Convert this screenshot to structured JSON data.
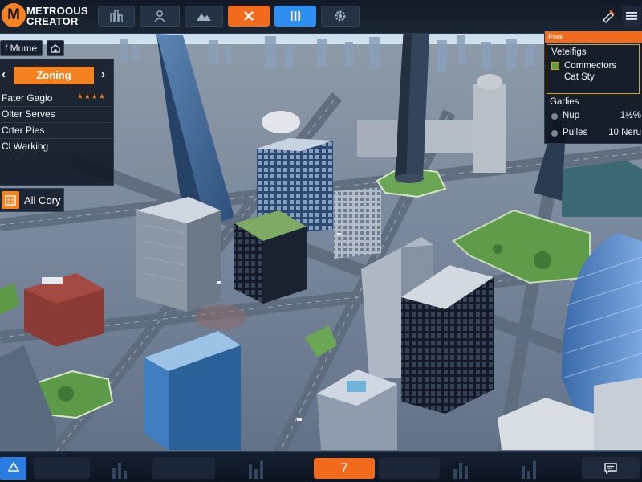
{
  "app": {
    "logo_letter": "M",
    "logo_line1": "METROOUS",
    "logo_line2": "CREATOR"
  },
  "toolbar": {
    "buttons": [
      {
        "icon": "city-buildings-icon",
        "state": "normal"
      },
      {
        "icon": "worker-icon",
        "state": "normal"
      },
      {
        "icon": "terrain-icon",
        "state": "normal"
      },
      {
        "icon": "close-icon",
        "state": "active-orange"
      },
      {
        "icon": "columns-icon",
        "state": "active-blue"
      },
      {
        "icon": "gear-icon",
        "state": "normal"
      }
    ],
    "right_icons": [
      "bulldoze-icon",
      "menu-icon"
    ]
  },
  "left_panel": {
    "chip_label": "f Mume",
    "chip_icon": "home-icon",
    "zoning_title": "Zoning",
    "items": [
      {
        "label": "Fater Gagio",
        "stars": "★★★★"
      },
      {
        "label": "Olter Serves"
      },
      {
        "label": "Crter Pies"
      },
      {
        "label": "Cl Warking"
      }
    ],
    "all_button": "All Cory"
  },
  "right_panel": {
    "header": "Pork",
    "section1_title": "Vetelfigs",
    "line1": "Commectors",
    "line2": "Cat Sty",
    "section2_title": "Garlies",
    "rows": [
      {
        "label": "Nup",
        "value": "1½%"
      },
      {
        "label": "Pulles",
        "value": "10 Neru"
      }
    ]
  },
  "bottom_bar": {
    "center_value": "7",
    "left_icon": "triangle-icon",
    "right_icon": "chat-icon"
  },
  "colors": {
    "accent_orange": "#f26a1c",
    "accent_blue": "#2f8ff0",
    "panel_bg": "#0e1622"
  }
}
